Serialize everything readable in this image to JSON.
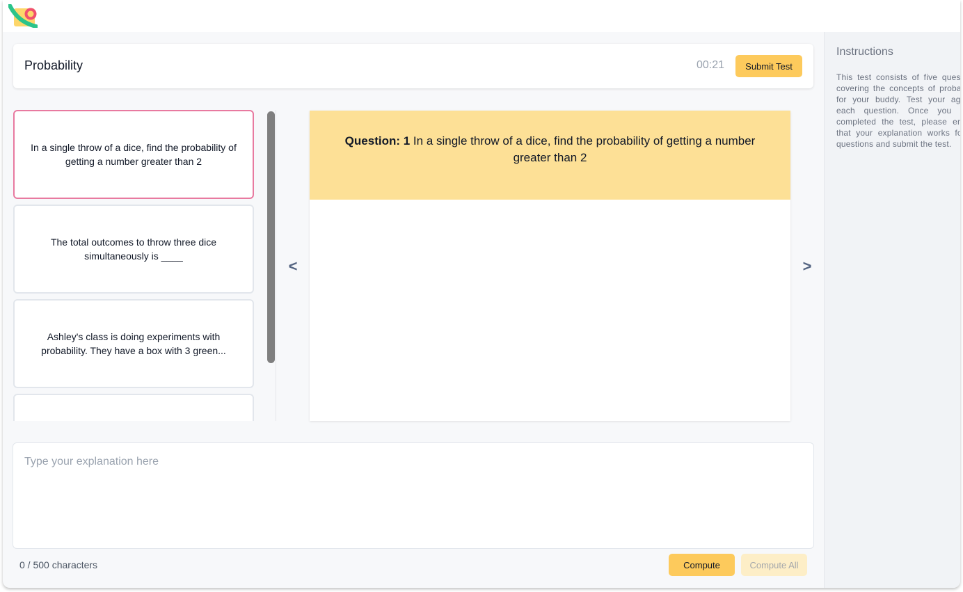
{
  "header": {
    "title": "Probability",
    "timer": "00:21",
    "submit_label": "Submit Test"
  },
  "questions": [
    {
      "text": "In a single throw of a dice, find the probability of getting a number greater than 2",
      "active": true
    },
    {
      "text": "The total outcomes to throw three dice simultaneously is ____",
      "active": false
    },
    {
      "text": "Ashley's class is doing experiments with probability. They have a box with 3 green...",
      "active": false
    },
    {
      "text": "",
      "active": false
    }
  ],
  "nav": {
    "prev": "<",
    "next": ">"
  },
  "current_question": {
    "label": "Question: 1",
    "text": "In a single throw of a dice, find the probability of getting a number greater than 2"
  },
  "explanation": {
    "placeholder": "Type your explanation here",
    "value": "",
    "char_count": "0 / 500 characters"
  },
  "actions": {
    "compute_label": "Compute",
    "compute_all_label": "Compute All"
  },
  "instructions": {
    "title": "Instructions",
    "text": "This test consists of five questions covering the concepts of probability for your buddy. Test your against each question. Once you have completed the test, please ensure that your explanation works for all questions and submit the test."
  },
  "colors": {
    "accent": "#fdca5c",
    "question_header_bg": "#fde096",
    "active_border": "#e87aa0",
    "disabled_button_bg": "#fdeec7"
  },
  "icons": {
    "logo": "brand-logo",
    "prev": "chevron-left-icon",
    "next": "chevron-right-icon"
  }
}
